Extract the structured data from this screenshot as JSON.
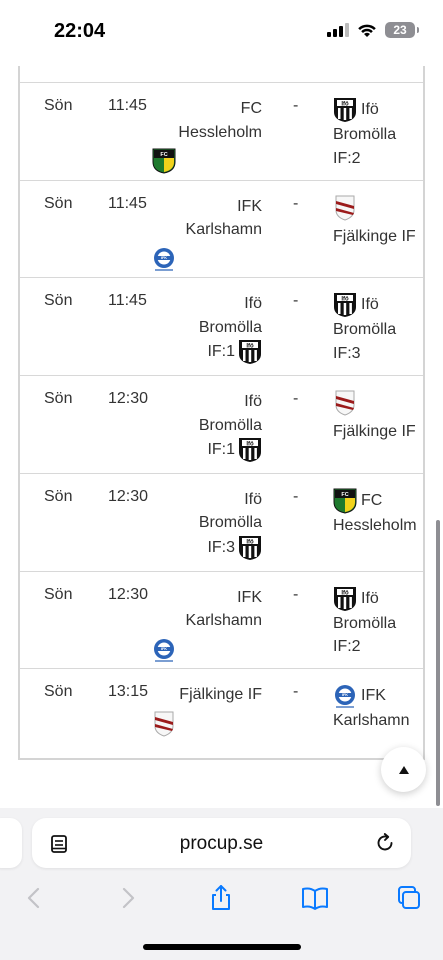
{
  "status_bar": {
    "time": "22:04",
    "battery": "23"
  },
  "matches": [
    {
      "day": "Sön",
      "time": "11:45",
      "home": {
        "lines": [
          "FC",
          "Hessleholm"
        ],
        "logo": "fc-hessleholm-logo",
        "logo_pos": "below"
      },
      "sep": "-",
      "away": {
        "lines": [
          "Ifö",
          "Bromölla",
          "IF:2"
        ],
        "logo": "ifo-bromolla-logo",
        "logo_pos": "inline-first"
      }
    },
    {
      "day": "Sön",
      "time": "11:45",
      "home": {
        "lines": [
          "IFK",
          "Karlshamn"
        ],
        "logo": "ifk-karlshamn-logo",
        "logo_pos": "below"
      },
      "sep": "-",
      "away": {
        "lines": [
          "Fjälkinge IF"
        ],
        "logo": "fjalkinge-if-logo",
        "logo_pos": "above"
      }
    },
    {
      "day": "Sön",
      "time": "11:45",
      "home": {
        "lines": [
          "Ifö",
          "Bromölla",
          "IF:1"
        ],
        "logo": "ifo-bromolla-logo",
        "logo_pos": "inline-last"
      },
      "sep": "-",
      "away": {
        "lines": [
          "Ifö",
          "Bromölla",
          "IF:3"
        ],
        "logo": "ifo-bromolla-logo",
        "logo_pos": "inline-first"
      }
    },
    {
      "day": "Sön",
      "time": "12:30",
      "home": {
        "lines": [
          "Ifö",
          "Bromölla",
          "IF:1"
        ],
        "logo": "ifo-bromolla-logo",
        "logo_pos": "inline-last"
      },
      "sep": "-",
      "away": {
        "lines": [
          "Fjälkinge IF"
        ],
        "logo": "fjalkinge-if-logo",
        "logo_pos": "above"
      }
    },
    {
      "day": "Sön",
      "time": "12:30",
      "home": {
        "lines": [
          "Ifö",
          "Bromölla",
          "IF:3"
        ],
        "logo": "ifo-bromolla-logo",
        "logo_pos": "inline-last"
      },
      "sep": "-",
      "away": {
        "lines": [
          "FC",
          "Hessleholm"
        ],
        "logo": "fc-hessleholm-logo",
        "logo_pos": "inline-first"
      }
    },
    {
      "day": "Sön",
      "time": "12:30",
      "home": {
        "lines": [
          "IFK",
          "Karlshamn"
        ],
        "logo": "ifk-karlshamn-logo",
        "logo_pos": "below"
      },
      "sep": "-",
      "away": {
        "lines": [
          "Ifö",
          "Bromölla",
          "IF:2"
        ],
        "logo": "ifo-bromolla-logo",
        "logo_pos": "inline-first"
      }
    },
    {
      "day": "Sön",
      "time": "13:15",
      "home": {
        "lines": [
          "Fjälkinge IF"
        ],
        "logo": "fjalkinge-if-logo",
        "logo_pos": "below"
      },
      "sep": "-",
      "away": {
        "lines": [
          "IFK",
          "Karlshamn"
        ],
        "logo": "ifk-karlshamn-logo",
        "logo_pos": "inline-first"
      }
    }
  ],
  "browser": {
    "url": "procup.se"
  },
  "icons": {
    "scroll_top": "chevron-up-icon",
    "reader": "reader-icon",
    "reload": "reload-icon",
    "back": "back-icon",
    "forward": "forward-icon",
    "share": "share-icon",
    "bookmarks": "bookmarks-icon",
    "tabs": "tabs-icon"
  },
  "colors": {
    "accent": "#0a7aff",
    "border": "#d4d4d4",
    "toolbar_bg": "#f2f2f4"
  }
}
